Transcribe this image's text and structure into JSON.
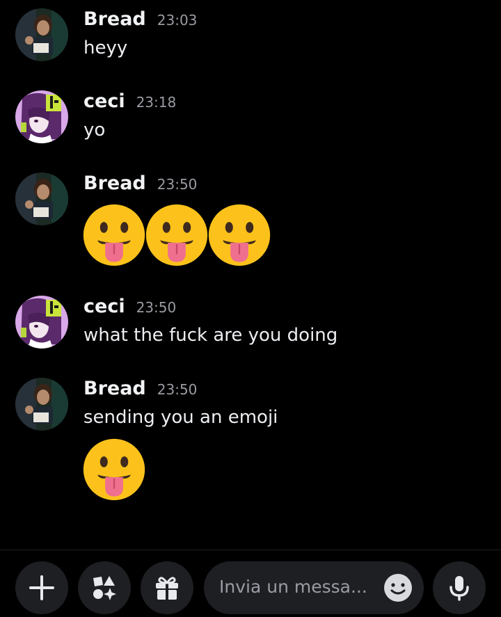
{
  "messages": [
    {
      "author": "Bread",
      "time": "23:03",
      "text": "heyy",
      "avatar": "bread-avatar"
    },
    {
      "author": "ceci",
      "time": "23:18",
      "text": "yo",
      "avatar": "ceci-avatar"
    },
    {
      "author": "Bread",
      "time": "23:50",
      "emoji": "stuck-out-tongue-emoji",
      "emoji_count": 3,
      "avatar": "bread-avatar"
    },
    {
      "author": "ceci",
      "time": "23:50",
      "text": "what the fuck are you doing",
      "avatar": "ceci-avatar"
    },
    {
      "author": "Bread",
      "time": "23:50",
      "text": "sending you an emoji",
      "emoji": "stuck-out-tongue-emoji",
      "emoji_count": 1,
      "avatar": "bread-avatar"
    }
  ],
  "composer": {
    "placeholder": "Invia un messa...",
    "buttons": [
      "plus-icon",
      "apps-icon",
      "gift-icon",
      "emoji-icon",
      "microphone-icon"
    ]
  },
  "colors": {
    "background": "#000000",
    "button_bg": "#1e1f23",
    "emoji_yellow": "#fcc21b",
    "tongue": "#ef6f8f"
  }
}
